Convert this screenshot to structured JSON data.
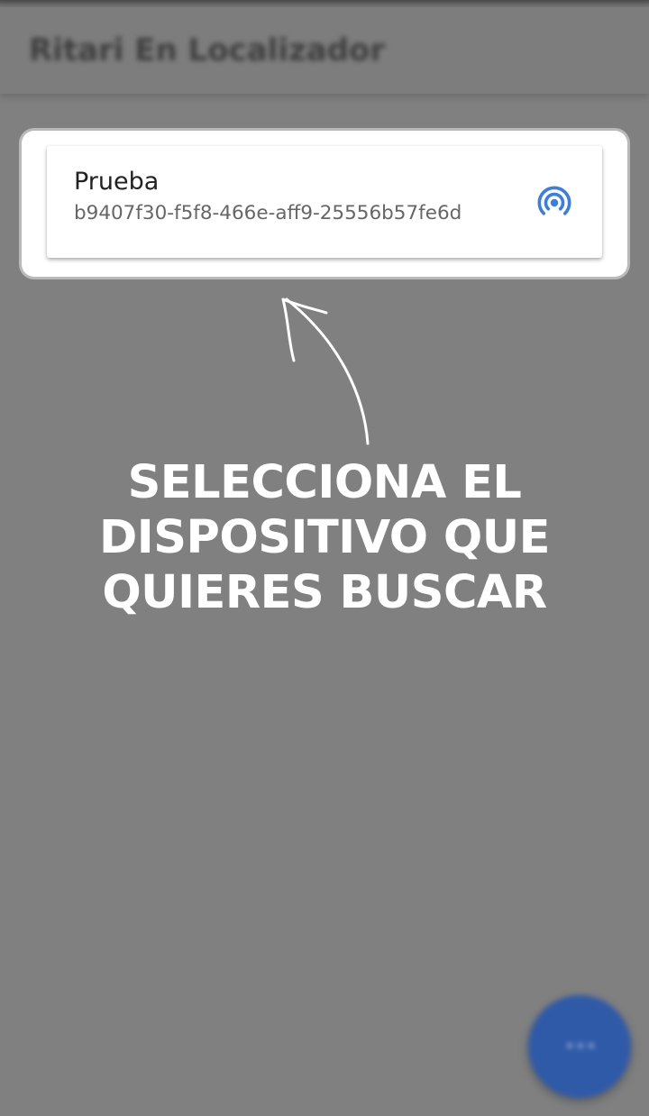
{
  "app_bar": {
    "title": "Ritari En Localizador"
  },
  "device_list": {
    "items": [
      {
        "name": "Prueba",
        "uuid": "b9407f30-f5f8-466e-aff9-25556b57fe6d",
        "icon": "signal-broadcast-icon"
      }
    ]
  },
  "overlay": {
    "instruction_lines": [
      "SELECCIONA EL",
      "DISPOSITIVO QUE",
      "QUIERES BUSCAR"
    ],
    "arrow_icon": "curved-arrow-icon"
  },
  "fab": {
    "icon": "more-icon"
  },
  "colors": {
    "overlay_background": "#808080",
    "accent_blue": "#3b7de6",
    "fab_blue": "#2f5aa8",
    "text_primary": "#222222",
    "text_secondary": "#666666",
    "instruction_text": "#ffffff"
  }
}
